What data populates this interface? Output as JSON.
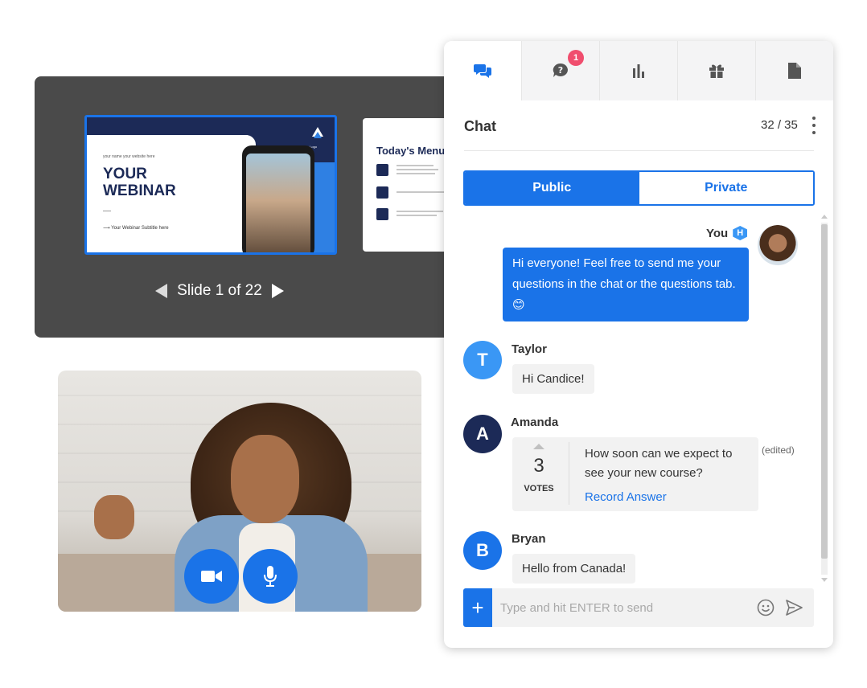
{
  "slides": {
    "main_slide": {
      "small_caption": "your name your website here",
      "title_line1": "YOUR",
      "title_line2": "WEBINAR",
      "subtitle": "Your Webinar Subtitle here",
      "logo_text": "Your Logo"
    },
    "next_slide": {
      "title": "Today's Menu"
    },
    "nav_label": "Slide 1 of 22"
  },
  "chat": {
    "tabs": [
      {
        "icon": "chat-bubbles-icon",
        "active": true
      },
      {
        "icon": "question-bubble-icon",
        "badge": "1"
      },
      {
        "icon": "bar-chart-icon"
      },
      {
        "icon": "gift-icon"
      },
      {
        "icon": "document-icon"
      }
    ],
    "title": "Chat",
    "count": "32 / 35",
    "segments": {
      "public": "Public",
      "private": "Private"
    },
    "messages": [
      {
        "sender": "You",
        "host_badge": "H",
        "text": "Hi everyone! Feel free to send me your questions in the chat or the questions tab. 😊"
      },
      {
        "sender": "Taylor",
        "initial": "T",
        "avatar_color": "#3a97f5",
        "text": "Hi Candice!"
      },
      {
        "sender": "Amanda",
        "initial": "A",
        "avatar_color": "#1c2a57",
        "votes": "3",
        "votes_label": "VOTES",
        "text": "How soon can we expect to see your new course?",
        "action": "Record Answer",
        "edited": "(edited)"
      },
      {
        "sender": "Bryan",
        "initial": "B",
        "avatar_color": "#1a73e8",
        "text": "Hello from Canada!"
      }
    ],
    "composer": {
      "placeholder": "Type and hit ENTER to send",
      "plus": "+"
    }
  },
  "colors": {
    "accent": "#1a73e8",
    "badge": "#f04e6e",
    "navy": "#1c2a57"
  }
}
